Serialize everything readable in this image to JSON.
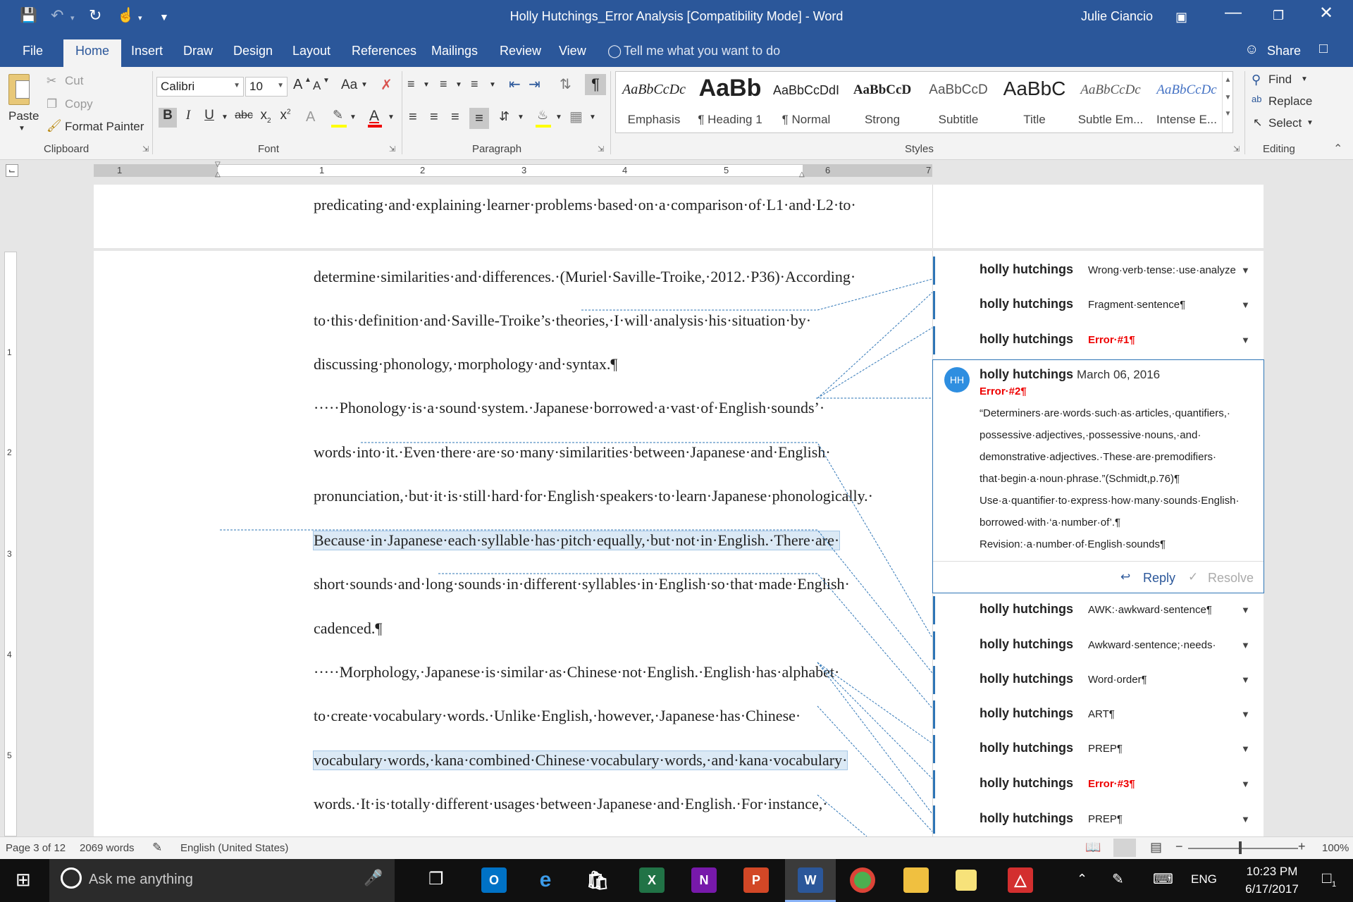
{
  "window": {
    "title": "Holly Hutchings_Error Analysis [Compatibility Mode]  -  Word",
    "user": "Julie Ciancio"
  },
  "tabs": [
    "File",
    "Home",
    "Insert",
    "Draw",
    "Design",
    "Layout",
    "References",
    "Mailings",
    "Review",
    "View"
  ],
  "tell_me": "Tell me what you want to do",
  "share": "Share",
  "clipboard": {
    "paste": "Paste",
    "cut": "Cut",
    "copy": "Copy",
    "format_painter": "Format Painter",
    "label": "Clipboard"
  },
  "font": {
    "name": "Calibri",
    "size": "10",
    "label": "Font",
    "grow": "A",
    "shrink": "A",
    "case": "Aa",
    "bold": "B",
    "italic": "I",
    "underline": "U",
    "strike": "abc",
    "sub": "x",
    "sup": "x"
  },
  "paragraph": {
    "label": "Paragraph"
  },
  "styles": {
    "label": "Styles",
    "items": [
      {
        "preview": "AaBbCcDc",
        "name": "Emphasis"
      },
      {
        "preview": "AaBb",
        "name": "¶ Heading 1"
      },
      {
        "preview": "AaBbCcDdI",
        "name": "¶ Normal"
      },
      {
        "preview": "AaBbCcD",
        "name": "Strong"
      },
      {
        "preview": "AaBbCcD",
        "name": "Subtitle"
      },
      {
        "preview": "AaBbC",
        "name": "Title"
      },
      {
        "preview": "AaBbCcDc",
        "name": "Subtle Em..."
      },
      {
        "preview": "AaBbCcDc",
        "name": "Intense E..."
      }
    ]
  },
  "editing": {
    "label": "Editing",
    "find": "Find",
    "replace": "Replace",
    "select": "Select"
  },
  "ruler": {
    "numbers": [
      "1",
      "1",
      "2",
      "3",
      "4",
      "5",
      "6",
      "7"
    ],
    "vnumbers": [
      "1",
      "2",
      "3",
      "4",
      "5"
    ]
  },
  "document": {
    "page1_line": "predicating·and·explaining·learner·problems·based·on·a·comparison·of·L1·and·L2·to·",
    "lines": [
      "determine·similarities·and·differences.·(Muriel·Saville-Troike,·2012.·P36)·According·",
      "to·this·definition·and·Saville-Troike’s·theories,·I·will·analysis·his·situation·by·",
      "discussing·phonology,·morphology·and·syntax.¶",
      "·····Phonology·is·a·sound·system.·Japanese·borrowed·a·vast·of·English·sounds’·",
      "words·into·it.·Even·there·are·so·many·similarities·between·Japanese·and·English·",
      "pronunciation,·but·it·is·still·hard·for·English·speakers·to·learn·Japanese·phonologically.·",
      "Because·in·Japanese·each·syllable·has·pitch·equally,·but·not·in·English.·There·are·",
      "short·sounds·and·long·sounds·in·different·syllables·in·English·so·that·made·English·",
      "cadenced.¶",
      "·····Morphology,·Japanese·is·similar·as·Chinese·not·English.·English·has·alphabet·",
      "to·create·vocabulary·words.·Unlike·English,·however,·Japanese·has·Chinese·",
      "vocabulary·words,·kana·combined·Chinese·vocabulary·words,·and·kana·vocabulary·",
      "words.·It·is·totally·different·usages·between·Japanese·and·English.·For·instance,·"
    ]
  },
  "comments": [
    {
      "author": "holly hutchings",
      "text": "Wrong·verb·tense:·use·analyze",
      "red": false
    },
    {
      "author": "holly hutchings",
      "text": "Fragment·sentence¶",
      "red": false
    },
    {
      "author": "holly hutchings",
      "text": "Error·#1¶",
      "red": true
    },
    {
      "author": "holly hutchings",
      "text": "AWK:·awkward·sentence¶",
      "red": false
    },
    {
      "author": "holly hutchings",
      "text": "Awkward·sentence;·needs·",
      "red": false
    },
    {
      "author": "holly hutchings",
      "text": "Word·order¶",
      "red": false
    },
    {
      "author": "holly hutchings",
      "text": "ART¶",
      "red": false
    },
    {
      "author": "holly hutchings",
      "text": "PREP¶",
      "red": false
    },
    {
      "author": "holly hutchings",
      "text": "Error·#3¶",
      "red": true
    },
    {
      "author": "holly hutchings",
      "text": "PREP¶",
      "red": false
    }
  ],
  "active_comment": {
    "initials": "HH",
    "author": "holly hutchings",
    "date": "March 06, 2016",
    "title": "Error·#2¶",
    "lines": [
      "“Determiners·are·words·such·as·articles,·quantifiers,·",
      "possessive·adjectives,·possessive·nouns,·and·",
      "demonstrative·adjectives.·These·are·premodifiers·",
      "that·begin·a·noun·phrase.”(Schmidt,p.76)¶",
      "Use·a·quantifier·to·express·how·many·sounds·English·",
      "borrowed·with·‘a·number·of’.¶",
      "Revision:·a·number·of·English·sounds¶"
    ],
    "reply": "Reply",
    "resolve": "Resolve"
  },
  "status": {
    "page": "Page 3 of 12",
    "words": "2069 words",
    "language": "English (United States)",
    "zoom": "100%"
  },
  "taskbar": {
    "search": "Ask me anything",
    "lang": "ENG",
    "time": "10:23 PM",
    "date": "6/17/2017",
    "notif": "1"
  },
  "colors": {
    "word_blue": "#2b579a",
    "accent": "#2e75b6",
    "error_red": "#e00000",
    "highlight": "#dbe9f5"
  }
}
